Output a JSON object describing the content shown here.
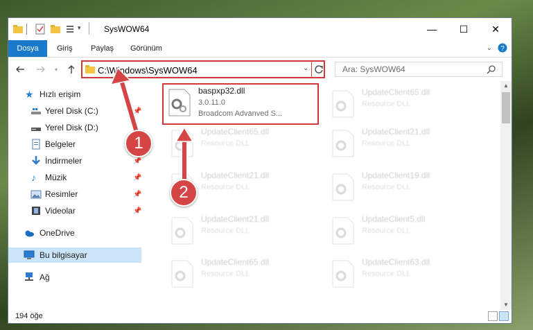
{
  "window": {
    "title": "SysWOW64",
    "minimize_label": "—",
    "maximize_label": "☐",
    "close_label": "✕"
  },
  "ribbon": {
    "tabs": [
      {
        "label": "Dosya"
      },
      {
        "label": "Giriş"
      },
      {
        "label": "Paylaş"
      },
      {
        "label": "Görünüm"
      }
    ]
  },
  "nav": {
    "address": "C:\\Windows\\SysWOW64",
    "search_placeholder": "Ara: SysWOW64"
  },
  "sidebar": {
    "items": [
      {
        "label": "Hızlı erişim",
        "icon": "star-icon"
      },
      {
        "label": "Yerel Disk (C:)",
        "icon": "drive-icon",
        "pinned": true
      },
      {
        "label": "Yerel Disk (D:)",
        "icon": "drive-icon",
        "pinned": false
      },
      {
        "label": "Belgeler",
        "icon": "document-icon",
        "pinned": true
      },
      {
        "label": "İndirmeler",
        "icon": "download-icon",
        "pinned": true
      },
      {
        "label": "Müzik",
        "icon": "music-icon",
        "pinned": true
      },
      {
        "label": "Resimler",
        "icon": "picture-icon",
        "pinned": true
      },
      {
        "label": "Videolar",
        "icon": "video-icon",
        "pinned": true
      },
      {
        "label": "OneDrive",
        "icon": "cloud-icon"
      },
      {
        "label": "Bu bilgisayar",
        "icon": "computer-icon",
        "selected": true
      },
      {
        "label": "Ağ",
        "icon": "network-icon"
      }
    ]
  },
  "files": {
    "highlighted": {
      "name": "baspxp32.dll",
      "line1": "3.0.11.0",
      "line2": "Broadcom Advanved S..."
    },
    "faded": [
      {
        "name": "UpdateClient65.dll",
        "type": "Resource DLL"
      },
      {
        "name": "UpdateClient65.dll",
        "type": "Resource DLL"
      },
      {
        "name": "UpdateClient21.dll",
        "type": "Resource DLL"
      },
      {
        "name": "UpdateClient21.dll",
        "type": "Resource DLL"
      },
      {
        "name": "UpdateClient19.dll",
        "type": "Resource DLL"
      },
      {
        "name": "UpdateClient21.dll",
        "type": "Resource DLL"
      },
      {
        "name": "UpdateClient5.dll",
        "type": "Resource DLL"
      },
      {
        "name": "UpdateClient65.dll",
        "type": "Resource DLL"
      },
      {
        "name": "UpdateClient63.dll",
        "type": "Resource DLL"
      }
    ]
  },
  "status": {
    "count": "194 öğe"
  },
  "annotations": {
    "badge1": "1",
    "badge2": "2",
    "color": "#d64545"
  }
}
